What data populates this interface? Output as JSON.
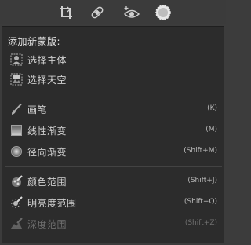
{
  "toolbar": {
    "tools": [
      {
        "name": "crop-icon"
      },
      {
        "name": "heal-icon"
      },
      {
        "name": "redeye-icon"
      },
      {
        "name": "mask-icon",
        "active": true
      }
    ]
  },
  "panel": {
    "caption": "添加新蒙版:",
    "auto": [
      {
        "label": "选择主体",
        "icon": "subject-icon"
      },
      {
        "label": "选择天空",
        "icon": "sky-icon"
      }
    ],
    "brushes": [
      {
        "label": "画笔",
        "shortcut": "(K)",
        "icon": "brush-icon"
      },
      {
        "label": "线性渐变",
        "shortcut": "(M)",
        "icon": "linear-gradient-icon"
      },
      {
        "label": "径向渐变",
        "shortcut": "(Shift+M)",
        "icon": "radial-gradient-icon"
      }
    ],
    "ranges": [
      {
        "label": "颜色范围",
        "shortcut": "(Shift+J)",
        "icon": "color-range-icon"
      },
      {
        "label": "明亮度范围",
        "shortcut": "(Shift+Q)",
        "icon": "luminance-range-icon"
      },
      {
        "label": "深度范围",
        "shortcut": "(Shift+Z)",
        "icon": "depth-range-icon",
        "disabled": true
      }
    ]
  }
}
